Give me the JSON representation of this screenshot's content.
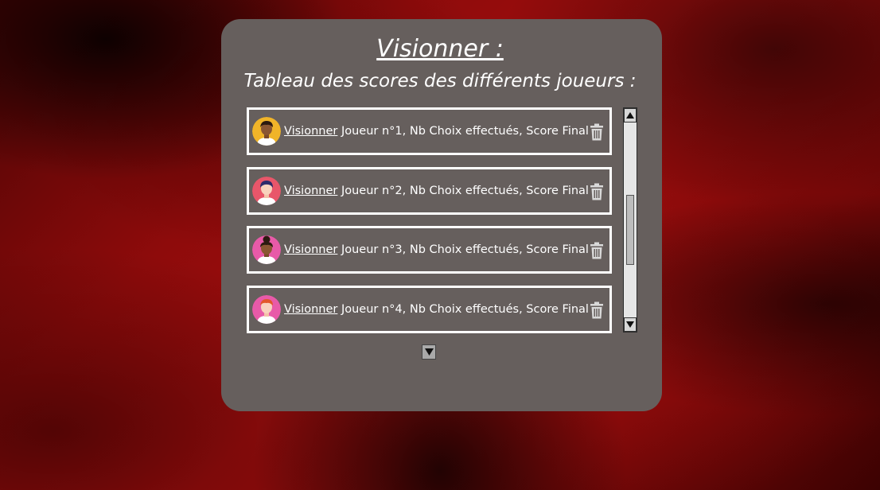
{
  "panel": {
    "title": "Visionner :",
    "subtitle": "Tableau des scores des différents joueurs :"
  },
  "players": [
    {
      "link_label": "Visionner",
      "info": " Joueur n°1, Nb Choix effectués, Score Final",
      "avatar_bg": "#f0b429",
      "avatar": "man-avatar-icon"
    },
    {
      "link_label": "Visionner",
      "info": " Joueur n°2, Nb Choix effectués, Score Final",
      "avatar_bg": "#e8566a",
      "avatar": "woman-avatar-icon"
    },
    {
      "link_label": "Visionner",
      "info": " Joueur n°3, Nb Choix effectués, Score Final",
      "avatar_bg": "#e85aa8",
      "avatar": "woman-bun-avatar-icon"
    },
    {
      "link_label": "Visionner",
      "info": " Joueur n°4, Nb Choix effectués, Score Final",
      "avatar_bg": "#e85aa8",
      "avatar": "man-redhair-avatar-icon"
    }
  ],
  "colors": {
    "panel_bg": "#665f5d",
    "row_border": "#ffffff",
    "trash": "#d9d9d9"
  }
}
